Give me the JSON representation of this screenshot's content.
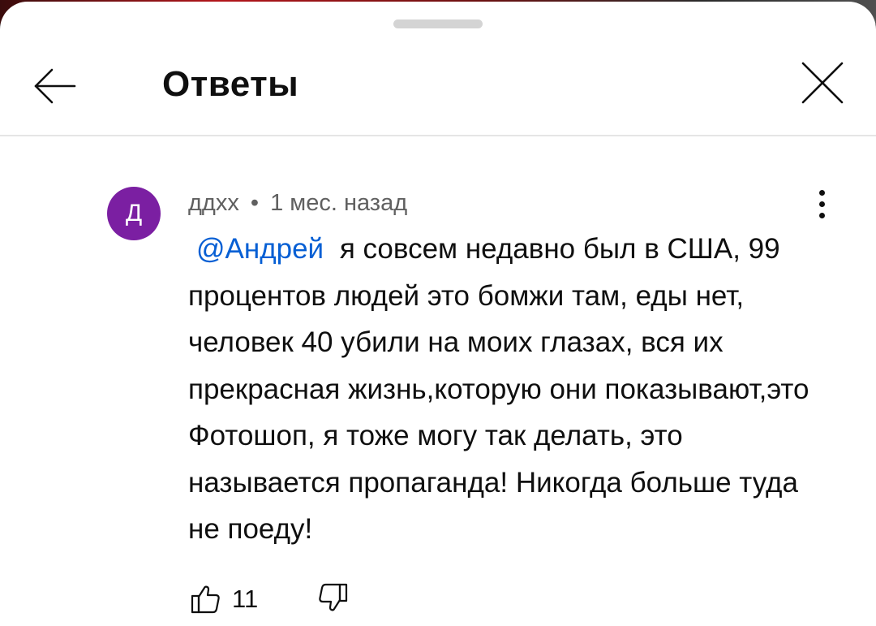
{
  "header": {
    "title": "Ответы"
  },
  "comment": {
    "avatar_letter": "Д",
    "avatar_color": "#7b1fa2",
    "author": "ддхх",
    "separator": "•",
    "time": "1 мес. назад",
    "mention": "@Андрей",
    "text": "я совсем недавно был в США, 99 процентов людей это бомжи там, еды нет, человек 40 убили на моих глазах, вся их прекрасная жизнь,которую они показывают,это Фотошоп, я тоже могу так делать, это называется пропаганда! Никогда больше туда не поеду!",
    "like_count": "11"
  },
  "icons": {
    "back": "arrow-back-icon",
    "close": "close-icon",
    "more": "more-vert-icon",
    "like": "thumb-up-icon",
    "dislike": "thumb-down-icon"
  },
  "colors": {
    "mention": "#065fd4",
    "meta_text": "#606060",
    "body_text": "#0f0f0f"
  }
}
